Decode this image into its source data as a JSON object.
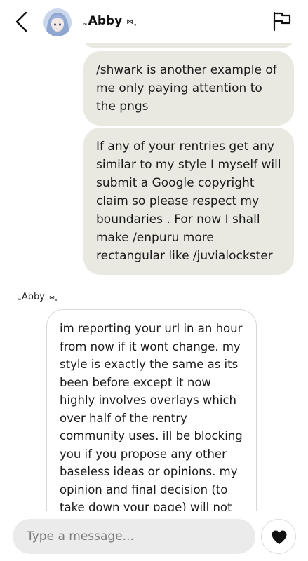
{
  "header": {
    "name_prefix": "∞",
    "name": "Abby",
    "name_suffix": "⋈˳",
    "back_icon": "chevron-left-icon",
    "report_icon": "flag-icon",
    "avatar_icon": "avatar"
  },
  "messages": {
    "outgoing": [
      {
        "text": "/shwark is another example of me only paying attention to the pngs"
      },
      {
        "text": "If any of your rentries get any similar to my style I myself will submit a Google copyright claim so please respect my boundaries . For now I shall make /enpuru more rectangular like /juvialockster"
      }
    ],
    "incoming_sender": {
      "prefix": "∞",
      "name": "Abby",
      "suffix": "⋈˳"
    },
    "incoming": [
      {
        "text": "im reporting your url in an hour from now if it wont change. my style is exactly the same as its been before except it now highly involves overlays which over half of the rentry community uses. ill be blocking you if you propose any other baseless ideas or opinions. my opinion and final decision (to take down your page) will not"
      }
    ]
  },
  "composer": {
    "placeholder": "Type a message...",
    "value": "",
    "send_icon": "heart-icon"
  },
  "colors": {
    "outgoing_bubble": "#e9e9e2",
    "input_bg": "#ebebeb",
    "text": "#1a1a1a"
  }
}
